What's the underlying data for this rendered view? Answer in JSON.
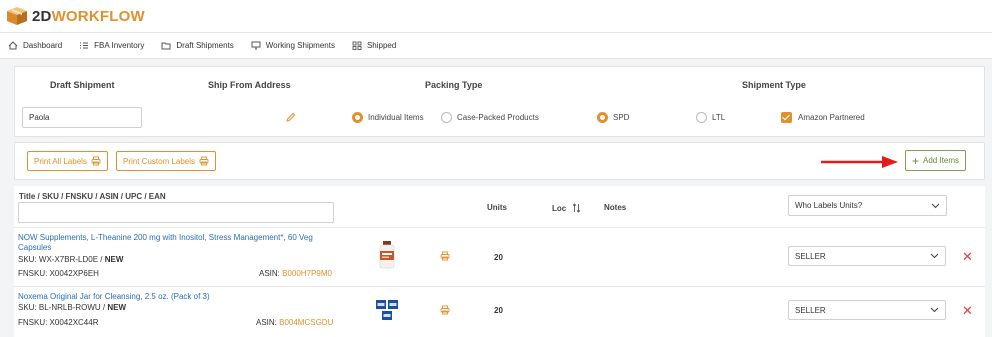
{
  "brand": {
    "part1": "2D",
    "part2": "WORKFLOW"
  },
  "nav": [
    {
      "label": "Dashboard",
      "icon": "home-icon"
    },
    {
      "label": "FBA Inventory",
      "icon": "list-icon"
    },
    {
      "label": "Draft Shipments",
      "icon": "folder-icon"
    },
    {
      "label": "Working Shipments",
      "icon": "monitor-icon"
    },
    {
      "label": "Shipped",
      "icon": "grid-icon"
    }
  ],
  "shipment": {
    "headers": {
      "draft": "Draft Shipment",
      "ship_from": "Ship From Address",
      "packing": "Packing Type",
      "shipment_type": "Shipment Type"
    },
    "draft_name": "Paola",
    "packing_options": [
      {
        "label": "Individual Items",
        "selected": true
      },
      {
        "label": "Case-Packed Products",
        "selected": false
      }
    ],
    "type_options": [
      {
        "label": "SPD",
        "selected": true
      },
      {
        "label": "LTL",
        "selected": false
      }
    ],
    "amazon_partnered": {
      "label": "Amazon Partnered",
      "checked": true
    }
  },
  "actions": {
    "print_all": "Print All Labels",
    "print_custom": "Print Custom Labels",
    "add_items": "Add Items"
  },
  "table": {
    "headers": {
      "title": "Title / SKU / FNSKU / ASIN / UPC / EAN",
      "units": "Units",
      "loc": "Loc",
      "notes": "Notes"
    },
    "search_value": "",
    "who_labels": "Who Labels Units?",
    "rows": [
      {
        "title": "NOW Supplements, L-Theanine 200 mg with Inositol, Stress Management*, 60 Veg Capsules",
        "sku_prefix": "SKU: ",
        "sku": "WX-X7BR-LD0E",
        "sku_sep": " / ",
        "condition": "NEW",
        "fnsku": "FNSKU: X0042XP6EH",
        "asin_label": "ASIN: ",
        "asin": "B000H7P9M0",
        "units": "20",
        "labeler": "SELLER"
      },
      {
        "title": "Noxema Original Jar for Cleansing, 2.5 oz. (Pack of 3)",
        "sku_prefix": "SKU: ",
        "sku": "BL-NRLB-ROWU",
        "sku_sep": " / ",
        "condition": "NEW",
        "fnsku": "FNSKU: X0042XC44R",
        "asin_label": "ASIN: ",
        "asin": "B004MCSGDU",
        "units": "20",
        "labeler": "SELLER"
      }
    ]
  },
  "colors": {
    "accent": "#e0912e",
    "link": "#2a6db5",
    "green": "#7ea54a",
    "danger": "#e04040",
    "arrow": "#e21b1b"
  }
}
